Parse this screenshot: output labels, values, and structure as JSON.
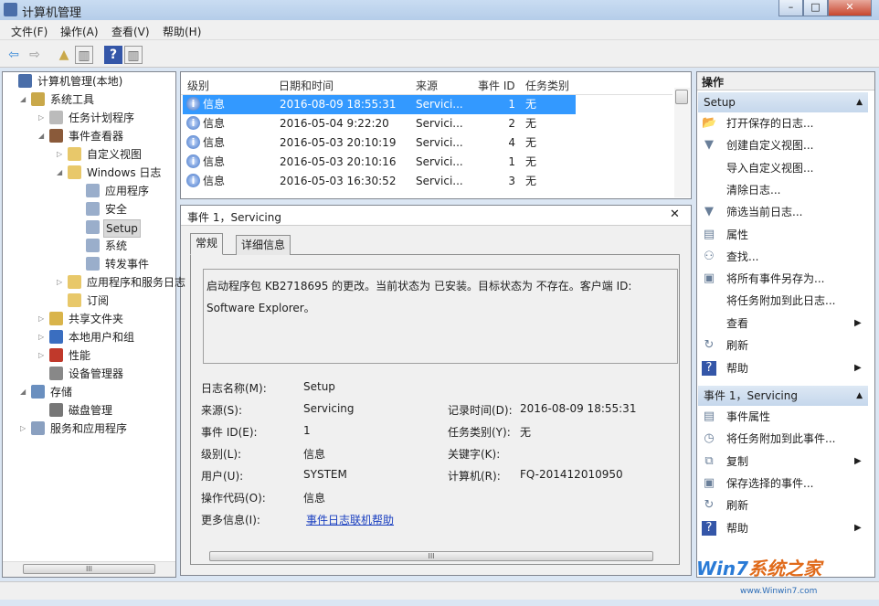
{
  "window": {
    "title": "计算机管理",
    "min": "–",
    "max": "□",
    "close": "✕"
  },
  "menu": [
    "文件(F)",
    "操作(A)",
    "查看(V)",
    "帮助(H)"
  ],
  "tree": [
    {
      "label": "计算机管理(本地)",
      "level": 0,
      "arrow": "",
      "icon": "computer-icon",
      "color": "#4a6ea9"
    },
    {
      "label": "系统工具",
      "level": 1,
      "arrow": "◢",
      "icon": "tools-icon",
      "color": "#c9a84a"
    },
    {
      "label": "任务计划程序",
      "level": 2,
      "arrow": "▷",
      "icon": "clock-icon",
      "color": "#bbbbbb"
    },
    {
      "label": "事件查看器",
      "level": 2,
      "arrow": "◢",
      "icon": "event-viewer-icon",
      "color": "#8a5a3a"
    },
    {
      "label": "自定义视图",
      "level": 3,
      "arrow": "▷",
      "icon": "folder-icon",
      "color": "#e8c86a"
    },
    {
      "label": "Windows 日志",
      "level": 3,
      "arrow": "◢",
      "icon": "folder-icon",
      "color": "#e8c86a"
    },
    {
      "label": "应用程序",
      "level": 4,
      "arrow": "",
      "icon": "log-icon",
      "color": "#9aaecb"
    },
    {
      "label": "安全",
      "level": 4,
      "arrow": "",
      "icon": "log-icon",
      "color": "#9aaecb"
    },
    {
      "label": "Setup",
      "level": 4,
      "arrow": "",
      "icon": "log-icon",
      "color": "#9aaecb",
      "selected": true
    },
    {
      "label": "系统",
      "level": 4,
      "arrow": "",
      "icon": "log-icon",
      "color": "#9aaecb"
    },
    {
      "label": "转发事件",
      "level": 4,
      "arrow": "",
      "icon": "log-icon",
      "color": "#9aaecb"
    },
    {
      "label": "应用程序和服务日志",
      "level": 3,
      "arrow": "▷",
      "icon": "folder-icon",
      "color": "#e8c86a"
    },
    {
      "label": "订阅",
      "level": 3,
      "arrow": "",
      "icon": "subscription-icon",
      "color": "#e8c86a"
    },
    {
      "label": "共享文件夹",
      "level": 2,
      "arrow": "▷",
      "icon": "shared-folder-icon",
      "color": "#d9b44a"
    },
    {
      "label": "本地用户和组",
      "level": 2,
      "arrow": "▷",
      "icon": "users-icon",
      "color": "#3a6ec0"
    },
    {
      "label": "性能",
      "level": 2,
      "arrow": "▷",
      "icon": "performance-icon",
      "color": "#c0392b"
    },
    {
      "label": "设备管理器",
      "level": 2,
      "arrow": "",
      "icon": "device-manager-icon",
      "color": "#888888"
    },
    {
      "label": "存储",
      "level": 1,
      "arrow": "◢",
      "icon": "storage-icon",
      "color": "#6a8fbf"
    },
    {
      "label": "磁盘管理",
      "level": 2,
      "arrow": "",
      "icon": "disk-icon",
      "color": "#777777"
    },
    {
      "label": "服务和应用程序",
      "level": 1,
      "arrow": "▷",
      "icon": "services-icon",
      "color": "#8aa0c0"
    }
  ],
  "list": {
    "headers": [
      "级别",
      "日期和时间",
      "来源",
      "事件 ID",
      "任务类别"
    ],
    "rows": [
      [
        "信息",
        "2016-08-09 18:55:31",
        "Servici...",
        "1",
        "无"
      ],
      [
        "信息",
        "2016-05-04 9:22:20",
        "Servici...",
        "2",
        "无"
      ],
      [
        "信息",
        "2016-05-03 20:10:19",
        "Servici...",
        "4",
        "无"
      ],
      [
        "信息",
        "2016-05-03 20:10:16",
        "Servici...",
        "1",
        "无"
      ],
      [
        "信息",
        "2016-05-03 16:30:52",
        "Servici...",
        "3",
        "无"
      ]
    ]
  },
  "detail": {
    "title": "事件 1，Servicing",
    "tabs": [
      "常规",
      "详细信息"
    ],
    "message": "启动程序包 KB2718695 的更改。当前状态为 已安装。目标状态为 不存在。客户端 ID: Software Explorer。",
    "fields_left": [
      {
        "label": "日志名称(M):",
        "value": "Setup"
      },
      {
        "label": "来源(S):",
        "value": "Servicing"
      },
      {
        "label": "事件 ID(E):",
        "value": "1"
      },
      {
        "label": "级别(L):",
        "value": "信息"
      },
      {
        "label": "用户(U):",
        "value": "SYSTEM"
      },
      {
        "label": "操作代码(O):",
        "value": "信息"
      },
      {
        "label": "更多信息(I):",
        "value": "事件日志联机帮助"
      }
    ],
    "fields_right": [
      {
        "label": "记录时间(D):",
        "value": "2016-08-09 18:55:31"
      },
      {
        "label": "任务类别(Y):",
        "value": "无"
      },
      {
        "label": "关键字(K):",
        "value": ""
      },
      {
        "label": "计算机(R):",
        "value": "FQ-201412010950"
      }
    ]
  },
  "actions": {
    "header": "操作",
    "sections": [
      {
        "title": "Setup",
        "items": [
          {
            "label": "打开保存的日志...",
            "icon": "open-folder-icon",
            "glyph": "📂"
          },
          {
            "label": "创建自定义视图...",
            "icon": "filter-create-icon",
            "glyph": "▼"
          },
          {
            "label": "导入自定义视图...",
            "icon": "",
            "glyph": ""
          },
          {
            "label": "清除日志...",
            "icon": "",
            "glyph": ""
          },
          {
            "label": "筛选当前日志...",
            "icon": "filter-icon",
            "glyph": "▼"
          },
          {
            "label": "属性",
            "icon": "properties-icon",
            "glyph": "▤"
          },
          {
            "label": "查找...",
            "icon": "find-icon",
            "glyph": "⚇"
          },
          {
            "label": "将所有事件另存为...",
            "icon": "save-icon",
            "glyph": "▣"
          },
          {
            "label": "将任务附加到此日志...",
            "icon": "",
            "glyph": ""
          },
          {
            "label": "查看",
            "icon": "",
            "glyph": "",
            "submenu": true
          },
          {
            "label": "刷新",
            "icon": "refresh-icon",
            "glyph": "↻"
          },
          {
            "label": "帮助",
            "icon": "help-icon",
            "glyph": "?",
            "submenu": true
          }
        ]
      },
      {
        "title": "事件 1，Servicing",
        "items": [
          {
            "label": "事件属性",
            "icon": "properties-icon",
            "glyph": "▤"
          },
          {
            "label": "将任务附加到此事件...",
            "icon": "task-icon",
            "glyph": "◷"
          },
          {
            "label": "复制",
            "icon": "copy-icon",
            "glyph": "⧉",
            "submenu": true
          },
          {
            "label": "保存选择的事件...",
            "icon": "save-icon",
            "glyph": "▣"
          },
          {
            "label": "刷新",
            "icon": "refresh-icon",
            "glyph": "↻"
          },
          {
            "label": "帮助",
            "icon": "help-icon",
            "glyph": "?",
            "submenu": true
          }
        ]
      }
    ]
  },
  "watermark": {
    "brand": "Win7系统之家",
    "url": "www.Winwin7.com"
  }
}
